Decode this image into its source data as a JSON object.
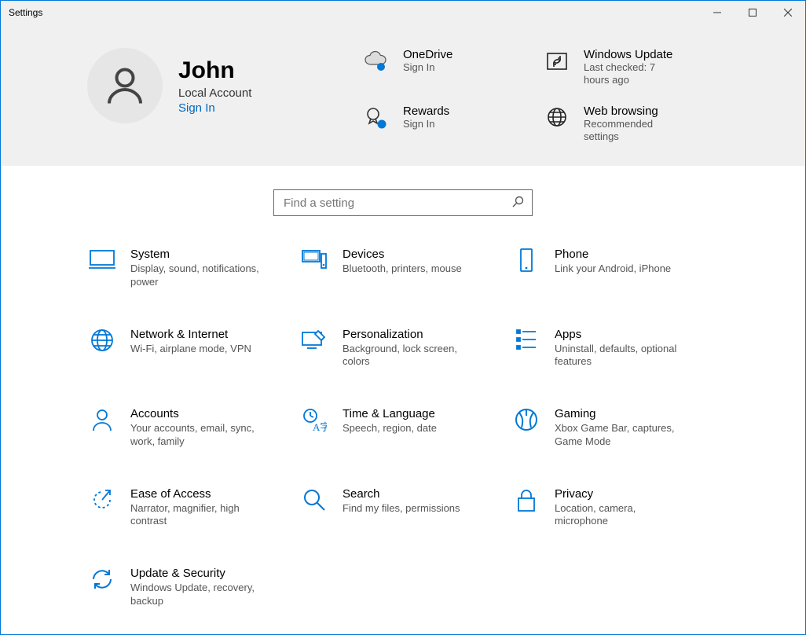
{
  "window": {
    "title": "Settings"
  },
  "profile": {
    "name": "John",
    "account_type": "Local Account",
    "signin_label": "Sign In"
  },
  "tiles": [
    {
      "id": "onedrive",
      "title": "OneDrive",
      "sub": "Sign In"
    },
    {
      "id": "windows-update",
      "title": "Windows Update",
      "sub": "Last checked: 7 hours ago"
    },
    {
      "id": "rewards",
      "title": "Rewards",
      "sub": "Sign In"
    },
    {
      "id": "web-browsing",
      "title": "Web browsing",
      "sub": "Recommended settings"
    }
  ],
  "search": {
    "placeholder": "Find a setting"
  },
  "categories": [
    {
      "id": "system",
      "title": "System",
      "desc": "Display, sound, notifications, power"
    },
    {
      "id": "devices",
      "title": "Devices",
      "desc": "Bluetooth, printers, mouse"
    },
    {
      "id": "phone",
      "title": "Phone",
      "desc": "Link your Android, iPhone"
    },
    {
      "id": "network",
      "title": "Network & Internet",
      "desc": "Wi-Fi, airplane mode, VPN"
    },
    {
      "id": "personalization",
      "title": "Personalization",
      "desc": "Background, lock screen, colors"
    },
    {
      "id": "apps",
      "title": "Apps",
      "desc": "Uninstall, defaults, optional features"
    },
    {
      "id": "accounts",
      "title": "Accounts",
      "desc": "Your accounts, email, sync, work, family"
    },
    {
      "id": "time",
      "title": "Time & Language",
      "desc": "Speech, region, date"
    },
    {
      "id": "gaming",
      "title": "Gaming",
      "desc": "Xbox Game Bar, captures, Game Mode"
    },
    {
      "id": "ease",
      "title": "Ease of Access",
      "desc": "Narrator, magnifier, high contrast"
    },
    {
      "id": "search",
      "title": "Search",
      "desc": "Find my files, permissions"
    },
    {
      "id": "privacy",
      "title": "Privacy",
      "desc": "Location, camera, microphone"
    },
    {
      "id": "update",
      "title": "Update & Security",
      "desc": "Windows Update, recovery, backup"
    }
  ]
}
